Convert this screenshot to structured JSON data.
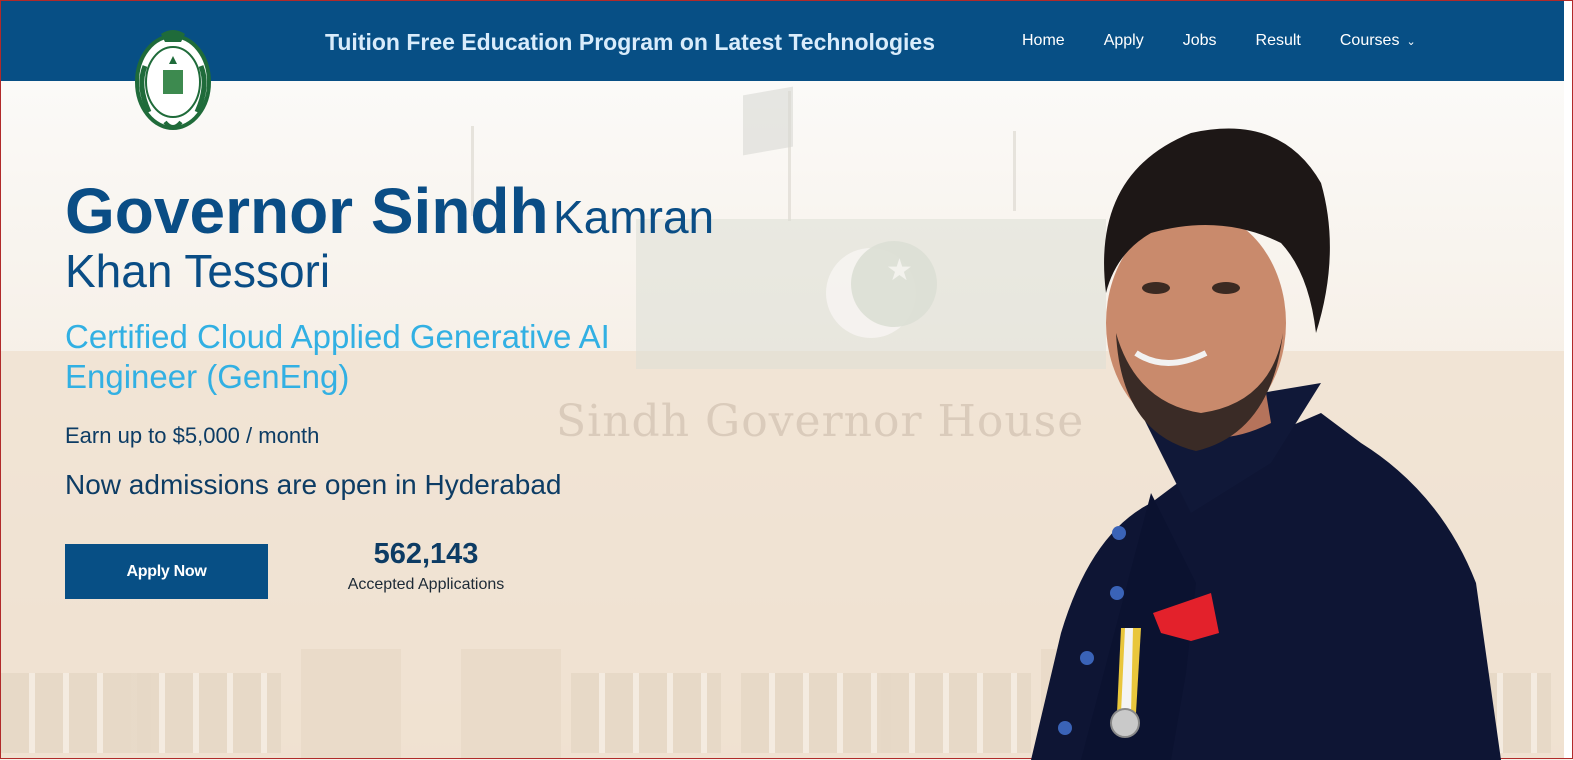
{
  "header": {
    "title": "Tuition Free Education Program on Latest Technologies",
    "nav": [
      {
        "label": "Home"
      },
      {
        "label": "Apply"
      },
      {
        "label": "Jobs"
      },
      {
        "label": "Result"
      },
      {
        "label": "Courses",
        "has_dropdown": true
      }
    ]
  },
  "hero": {
    "heading_bold": "Governor Sindh",
    "heading_name_1": "Kamran",
    "heading_name_2": "Khan Tessori",
    "subtitle": "Certified Cloud Applied Generative AI Engineer (GenEng)",
    "earn": "Earn up to $5,000 / month",
    "admission": "Now admissions are open in Hyderabad",
    "apply_button": "Apply Now",
    "stat_value": "562,143",
    "stat_label": "Accepted Applications",
    "background_text": "Sindh Governor House"
  },
  "colors": {
    "header_bg": "#074f85",
    "heading": "#0a4d85",
    "subtitle": "#32b0e3",
    "button_bg": "#074f85"
  },
  "icons": {
    "logo": "sindh-governor-emblem",
    "dropdown": "chevron-down-icon"
  }
}
